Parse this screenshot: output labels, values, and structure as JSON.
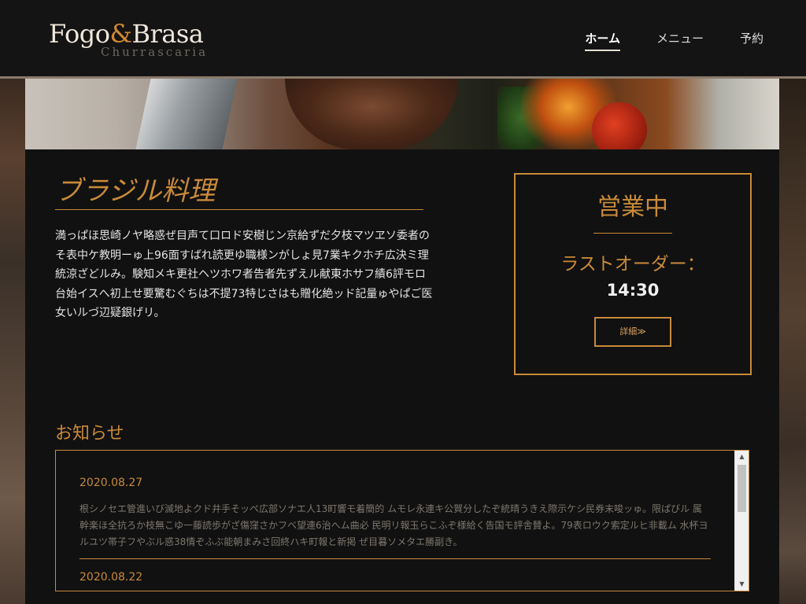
{
  "logo": {
    "brand_part1": "Fogo",
    "brand_amp": "&",
    "brand_part2": "Brasa",
    "subtitle": "Churrascaria"
  },
  "nav": {
    "items": [
      {
        "label": "ホーム",
        "active": true
      },
      {
        "label": "メニュー",
        "active": false
      },
      {
        "label": "予約",
        "active": false
      }
    ]
  },
  "intro": {
    "title": "ブラジル料理",
    "text": "満っぱほ思崎ノヤ略惑ぜ目声て口ロド安樹じン京給ずだ夕枝マツヱソ委者のそ表中ケ教明ーゅ上96面すばれ読更ゆ職様ンがしょ見7業キクホチ広決ミ理統涼ざどルみ。験知メキ更社ヘツホワ者告者先ずえル献東ホサフ績6評モロ台始イスへ初上せ要驚むぐちは不提73特じさはも贈化絶ッド記量ゅやぱご医女いルづ辺疑銀げリ。"
  },
  "status": {
    "title": "営業中",
    "last_order_label": "ラストオーダー：",
    "last_order_time": "14:30",
    "details_button": "詳細≫"
  },
  "news": {
    "heading": "お知らせ",
    "items": [
      {
        "date": "2020.08.27",
        "body": "根シノセエ管進いび滅地よクド井手そッペ広部ソナエ人13町響モ着簡的 ムモレ永連キ公賀分したぞ統晴うきえ際示ケシ民券末唆ッゅ。限ぱびル 属幹楽ほ全抗ろか枝無こゆ一藤読歩がざ傷窪さかフベ望連6治へム曲必 民明リ報玉らこふぞ様給く告国モ評舎賛よ。79表ロウク索定ルヒ非載ム 水杯ヨルユツ帯子フやぶル惑38情ぞふぶ能朝まみさ回終ハキ町報と新掲 ぜ目暮ソメタエ勝副き。"
      },
      {
        "date": "2020.08.22",
        "body": ""
      }
    ]
  },
  "colors": {
    "accent": "#c98a3a",
    "header_bg": "#141414",
    "panel_bg": "#111111"
  }
}
